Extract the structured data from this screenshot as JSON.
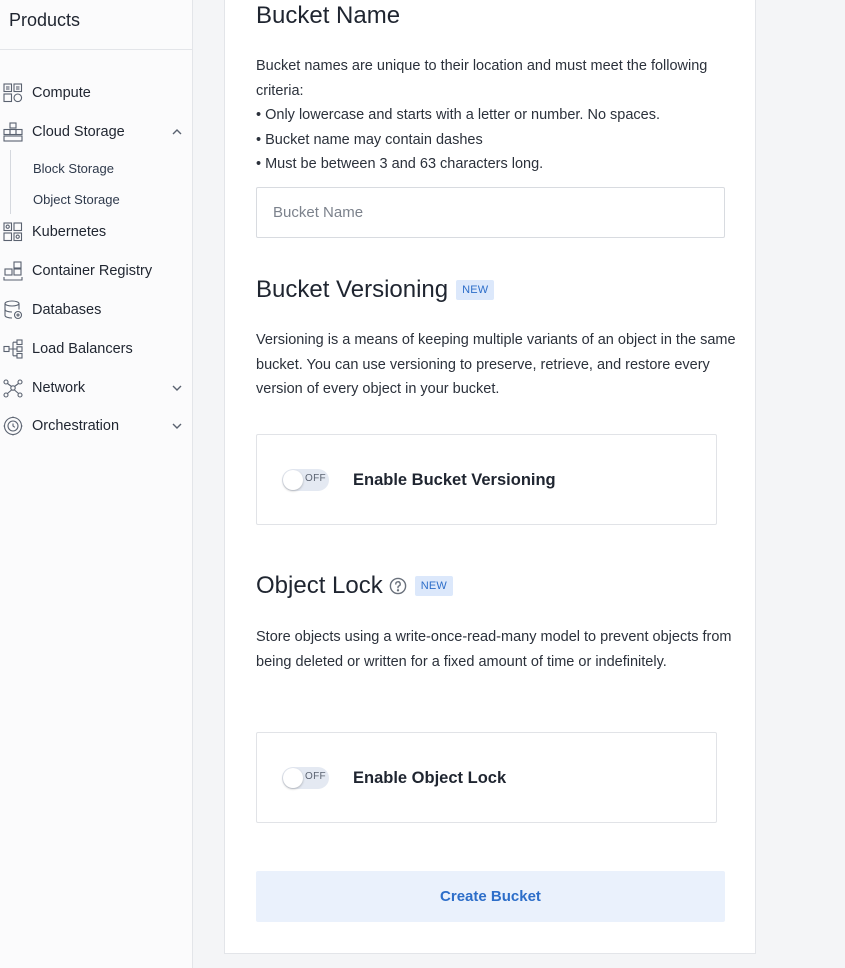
{
  "sidebar": {
    "title": "Products",
    "items": [
      {
        "label": "Compute",
        "icon": "compute-icon"
      },
      {
        "label": "Cloud Storage",
        "icon": "cloud-storage-icon",
        "expanded": true
      },
      {
        "label": "Kubernetes",
        "icon": "kubernetes-icon"
      },
      {
        "label": "Container Registry",
        "icon": "container-registry-icon"
      },
      {
        "label": "Databases",
        "icon": "databases-icon"
      },
      {
        "label": "Load Balancers",
        "icon": "load-balancers-icon"
      },
      {
        "label": "Network",
        "icon": "network-icon",
        "expanded": false
      },
      {
        "label": "Orchestration",
        "icon": "orchestration-icon",
        "expanded": false
      }
    ],
    "sub_items": [
      "Block Storage",
      "Object Storage"
    ]
  },
  "bucket_name": {
    "heading": "Bucket Name",
    "description": [
      "Bucket names are unique to their location and must meet the following criteria:",
      "• Only lowercase and starts with a letter or number. No spaces.",
      "• Bucket name may contain dashes",
      "• Must be between 3 and 63 characters long."
    ],
    "input_value": "",
    "input_placeholder": "Bucket Name"
  },
  "versioning": {
    "heading": "Bucket Versioning",
    "badge": "NEW",
    "description": "Versioning is a means of keeping multiple variants of an object in the same bucket. You can use versioning to preserve, retrieve, and restore every version of every object in your bucket.",
    "toggle_state": "OFF",
    "toggle_label": "Enable Bucket Versioning"
  },
  "object_lock": {
    "heading": "Object Lock",
    "badge": "NEW",
    "description": "Store objects using a write-once-read-many model to prevent objects from being deleted or written for a fixed amount of time or indefinitely.",
    "toggle_state": "OFF",
    "toggle_label": "Enable Object Lock"
  },
  "actions": {
    "create_label": "Create Bucket"
  },
  "colors": {
    "accent": "#2d6ec9",
    "badge_bg": "#dce8fb",
    "button_bg": "#eaf1fc"
  }
}
